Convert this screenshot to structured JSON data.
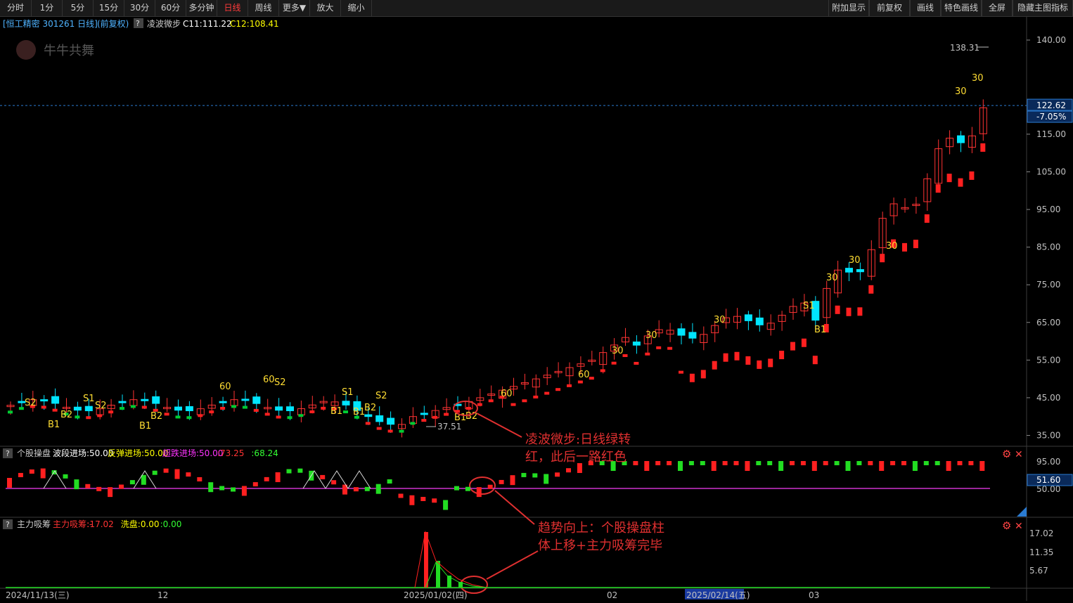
{
  "toolbar": {
    "left": [
      "分时",
      "1分",
      "5分",
      "15分",
      "30分",
      "60分",
      "多分钟",
      "日线",
      "周线",
      "更多▼",
      "放大",
      "缩小"
    ],
    "active": "日线",
    "right": [
      "附加显示",
      "前复权",
      "画线",
      "特色画线",
      "全屏",
      "隐藏主图指标"
    ]
  },
  "main_panel": {
    "stock_label": "[恒工精密 301261 日线]",
    "adjust_label": "(前复权)",
    "indicator_name": "凌波微步",
    "c11": "C11:111.22",
    "c12": "C12:108.41",
    "watermark": "牛牛共舞",
    "high_label": "138.31",
    "low_label": "37.51",
    "price_axis": [
      "140.00",
      "115.00",
      "105.00",
      "95.00",
      "85.00",
      "75.00",
      "65.00",
      "55.00",
      "45.00",
      "35.00"
    ],
    "crosshair_price": "122.62",
    "crosshair_pct": "-7.05%"
  },
  "sub_panel_1": {
    "name": "个股操盘",
    "params": [
      {
        "text": "波段进场:50.00",
        "color": "#ffffff"
      },
      {
        "text": "反弹进场:50.00",
        "color": "#ffff00"
      },
      {
        "text": "超跌进场:50.00",
        "color": "#ff33ff"
      },
      {
        "text": ":73.25",
        "color": "#ff3333"
      },
      {
        "text": ":68.24",
        "color": "#33ff33"
      }
    ],
    "axis": [
      "95.00",
      "50.00"
    ],
    "current_value": "51.60"
  },
  "sub_panel_2": {
    "name": "主力吸筹",
    "params": [
      {
        "text": "主力吸筹:-",
        "color": "#ff3333"
      },
      {
        "text": ":17.02",
        "color": "#ff3333"
      },
      {
        "text": "洗盘:0.00",
        "color": "#ffff00"
      },
      {
        "text": ":0.00",
        "color": "#33ff33"
      }
    ],
    "axis": [
      "17.02",
      "11.35",
      "5.67"
    ]
  },
  "time_axis": {
    "labels": [
      "2024/11/13(三)",
      "12",
      "2025/01/02(四)",
      "02",
      "2025/02/14(五)",
      "03"
    ]
  },
  "signals": {
    "labels": [
      "S2",
      "S1",
      "S2",
      "B1",
      "B2",
      "B1",
      "B2",
      "60",
      "S2",
      "60",
      "S1",
      "S2",
      "B1",
      "B1",
      "B2",
      "60",
      "B1",
      "B2",
      "60",
      "30",
      "30",
      "30",
      "30",
      "30",
      "S1",
      "B1",
      "30",
      "30",
      "30"
    ]
  },
  "annotations": {
    "note1_line1": "凌波微步:日线绿转",
    "note1_line2": "红，此后一路红色",
    "note2_line1": "趋势向上：个股操盘柱",
    "note2_line2": "体上移+主力吸筹完毕"
  },
  "colors": {
    "up": "#ff3333",
    "down": "#00e5ff",
    "axis_text": "#c0c0c0",
    "signal_text": "#ffdd33",
    "annotation": "#e03030",
    "hline": "#2a7bd1"
  }
}
